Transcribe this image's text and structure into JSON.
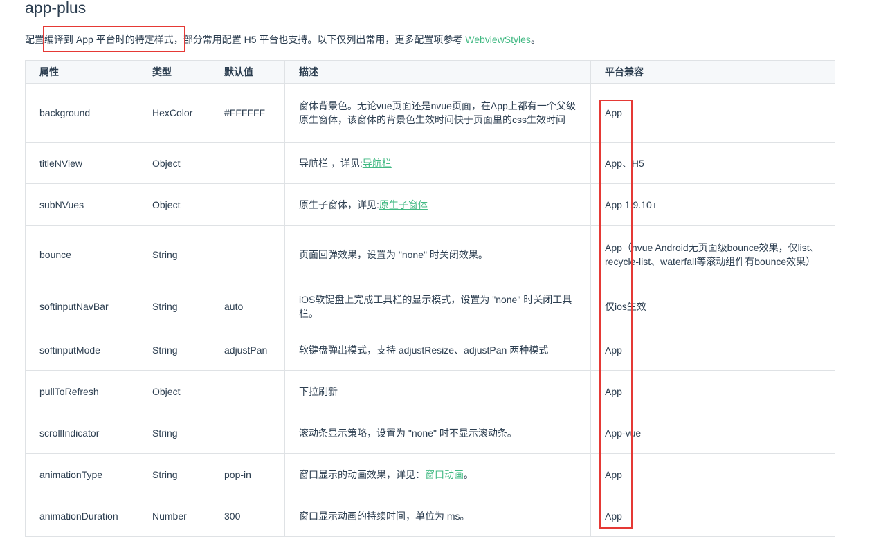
{
  "heading": "app-plus",
  "intro": {
    "text_before": "配置编译到 App 平台时的特定样式，部分常用配置 H5 平台也支持。以下仅列出常用，更多配置项参考 ",
    "link": "WebviewStyles",
    "text_after": "。"
  },
  "table": {
    "headers": [
      "属性",
      "类型",
      "默认值",
      "描述",
      "平台兼容"
    ],
    "rows": [
      {
        "prop": "background",
        "type": "HexColor",
        "default": "#FFFFFF",
        "desc": "窗体背景色。无论vue页面还是nvue页面，在App上都有一个父级原生窗体，该窗体的背景色生效时间快于页面里的css生效时间",
        "desc_link": "",
        "desc_after": "",
        "platform": "App"
      },
      {
        "prop": "titleNView",
        "type": "Object",
        "default": "",
        "desc": "导航栏 ，详见:",
        "desc_link": "导航栏",
        "desc_after": "",
        "platform": "App、H5"
      },
      {
        "prop": "subNVues",
        "type": "Object",
        "default": "",
        "desc": "原生子窗体，详见:",
        "desc_link": "原生子窗体",
        "desc_after": "",
        "platform": "App 1.9.10+"
      },
      {
        "prop": "bounce",
        "type": "String",
        "default": "",
        "desc": "页面回弹效果，设置为 \"none\" 时关闭效果。",
        "desc_link": "",
        "desc_after": "",
        "platform": "App（nvue Android无页面级bounce效果，仅list、recycle-list、waterfall等滚动组件有bounce效果）"
      },
      {
        "prop": "softinputNavBar",
        "type": "String",
        "default": "auto",
        "desc": "iOS软键盘上完成工具栏的显示模式，设置为 \"none\" 时关闭工具栏。",
        "desc_link": "",
        "desc_after": "",
        "platform": "仅ios生效"
      },
      {
        "prop": "softinputMode",
        "type": "String",
        "default": "adjustPan",
        "desc": "软键盘弹出模式，支持 adjustResize、adjustPan 两种模式",
        "desc_link": "",
        "desc_after": "",
        "platform": "App"
      },
      {
        "prop": "pullToRefresh",
        "type": "Object",
        "default": "",
        "desc": "下拉刷新",
        "desc_link": "",
        "desc_after": "",
        "platform": "App"
      },
      {
        "prop": "scrollIndicator",
        "type": "String",
        "default": "",
        "desc": "滚动条显示策略，设置为 \"none\" 时不显示滚动条。",
        "desc_link": "",
        "desc_after": "",
        "platform": "App-vue"
      },
      {
        "prop": "animationType",
        "type": "String",
        "default": "pop-in",
        "desc": "窗口显示的动画效果，详见：",
        "desc_link": "窗口动画",
        "desc_after": "。",
        "platform": "App"
      },
      {
        "prop": "animationDuration",
        "type": "Number",
        "default": "300",
        "desc": "窗口显示动画的持续时间，单位为 ms。",
        "desc_link": "",
        "desc_after": "",
        "platform": "App"
      }
    ]
  },
  "colors": {
    "text": "#2c3e50",
    "link": "#42b983",
    "border": "#dfe2e5",
    "header_bg": "#f6f8fa",
    "highlight": "#e53935"
  }
}
